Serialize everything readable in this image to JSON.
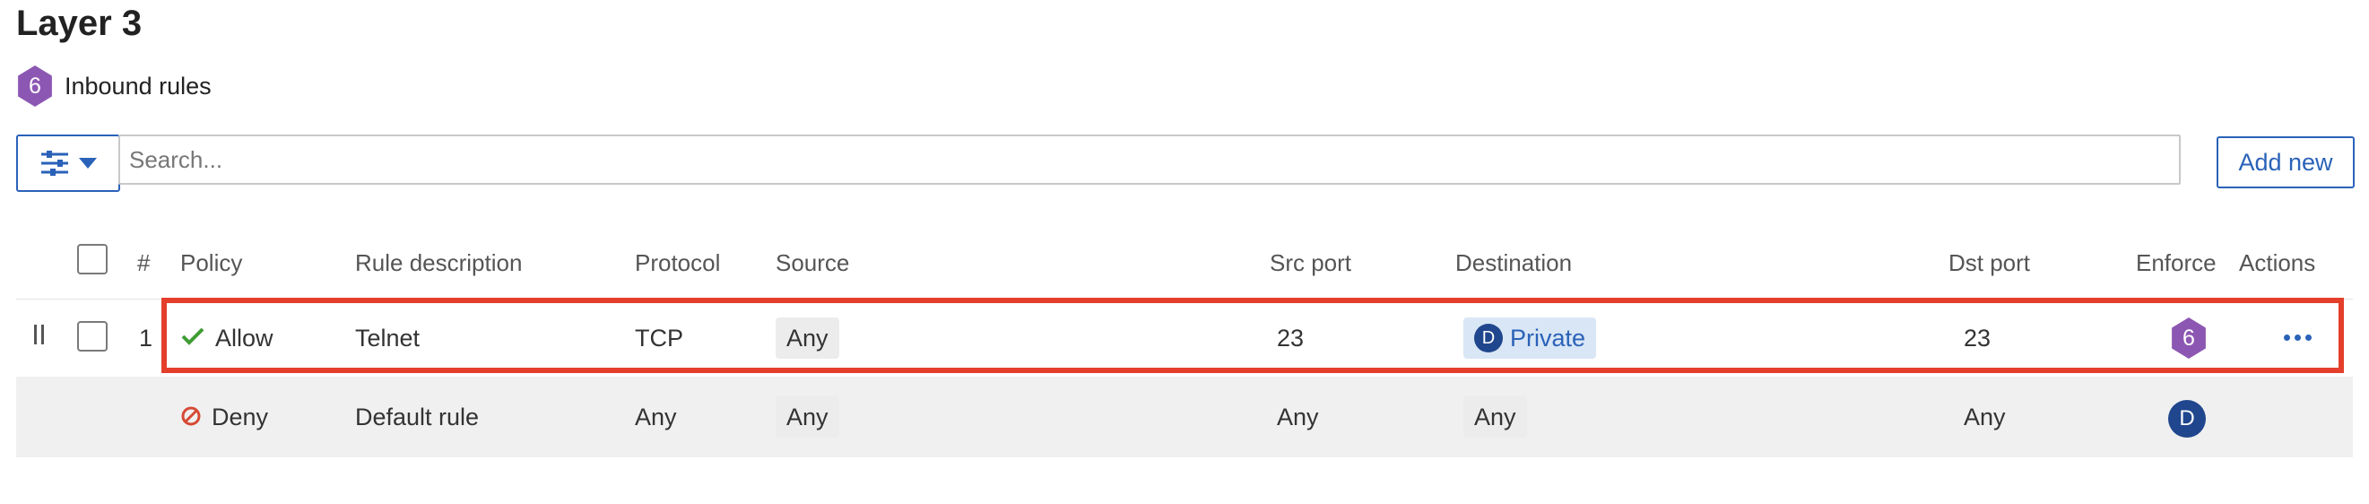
{
  "page": {
    "title": "Layer 3"
  },
  "rules": {
    "count": "6",
    "label": "Inbound rules"
  },
  "toolbar": {
    "filter_icon": "sliders-icon",
    "search_placeholder": "Search...",
    "search_value": "",
    "add_label": "Add new"
  },
  "table": {
    "headers": {
      "index": "#",
      "policy": "Policy",
      "description": "Rule description",
      "protocol": "Protocol",
      "source": "Source",
      "src_port": "Src port",
      "destination": "Destination",
      "dst_port": "Dst port",
      "enforce": "Enforce",
      "actions": "Actions"
    },
    "rows": [
      {
        "index": "1",
        "policy": "Allow",
        "policy_icon": "check-icon",
        "description": "Telnet",
        "protocol": "TCP",
        "source": "Any",
        "src_port": "23",
        "destination_badge": "D",
        "destination": "Private",
        "dst_port": "23",
        "enforce": "6",
        "highlighted": true
      },
      {
        "index": "",
        "policy": "Deny",
        "policy_icon": "block-icon",
        "description": "Default rule",
        "protocol": "Any",
        "source": "Any",
        "src_port": "Any",
        "destination": "Any",
        "dst_port": "Any",
        "enforce": "D"
      }
    ]
  },
  "colors": {
    "accent": "#2a62b8",
    "highlight": "#e43f2c",
    "allow": "#3f9c35",
    "deny": "#d64a35",
    "hex_badge": "#8c57b2",
    "avatar": "#20468d"
  }
}
